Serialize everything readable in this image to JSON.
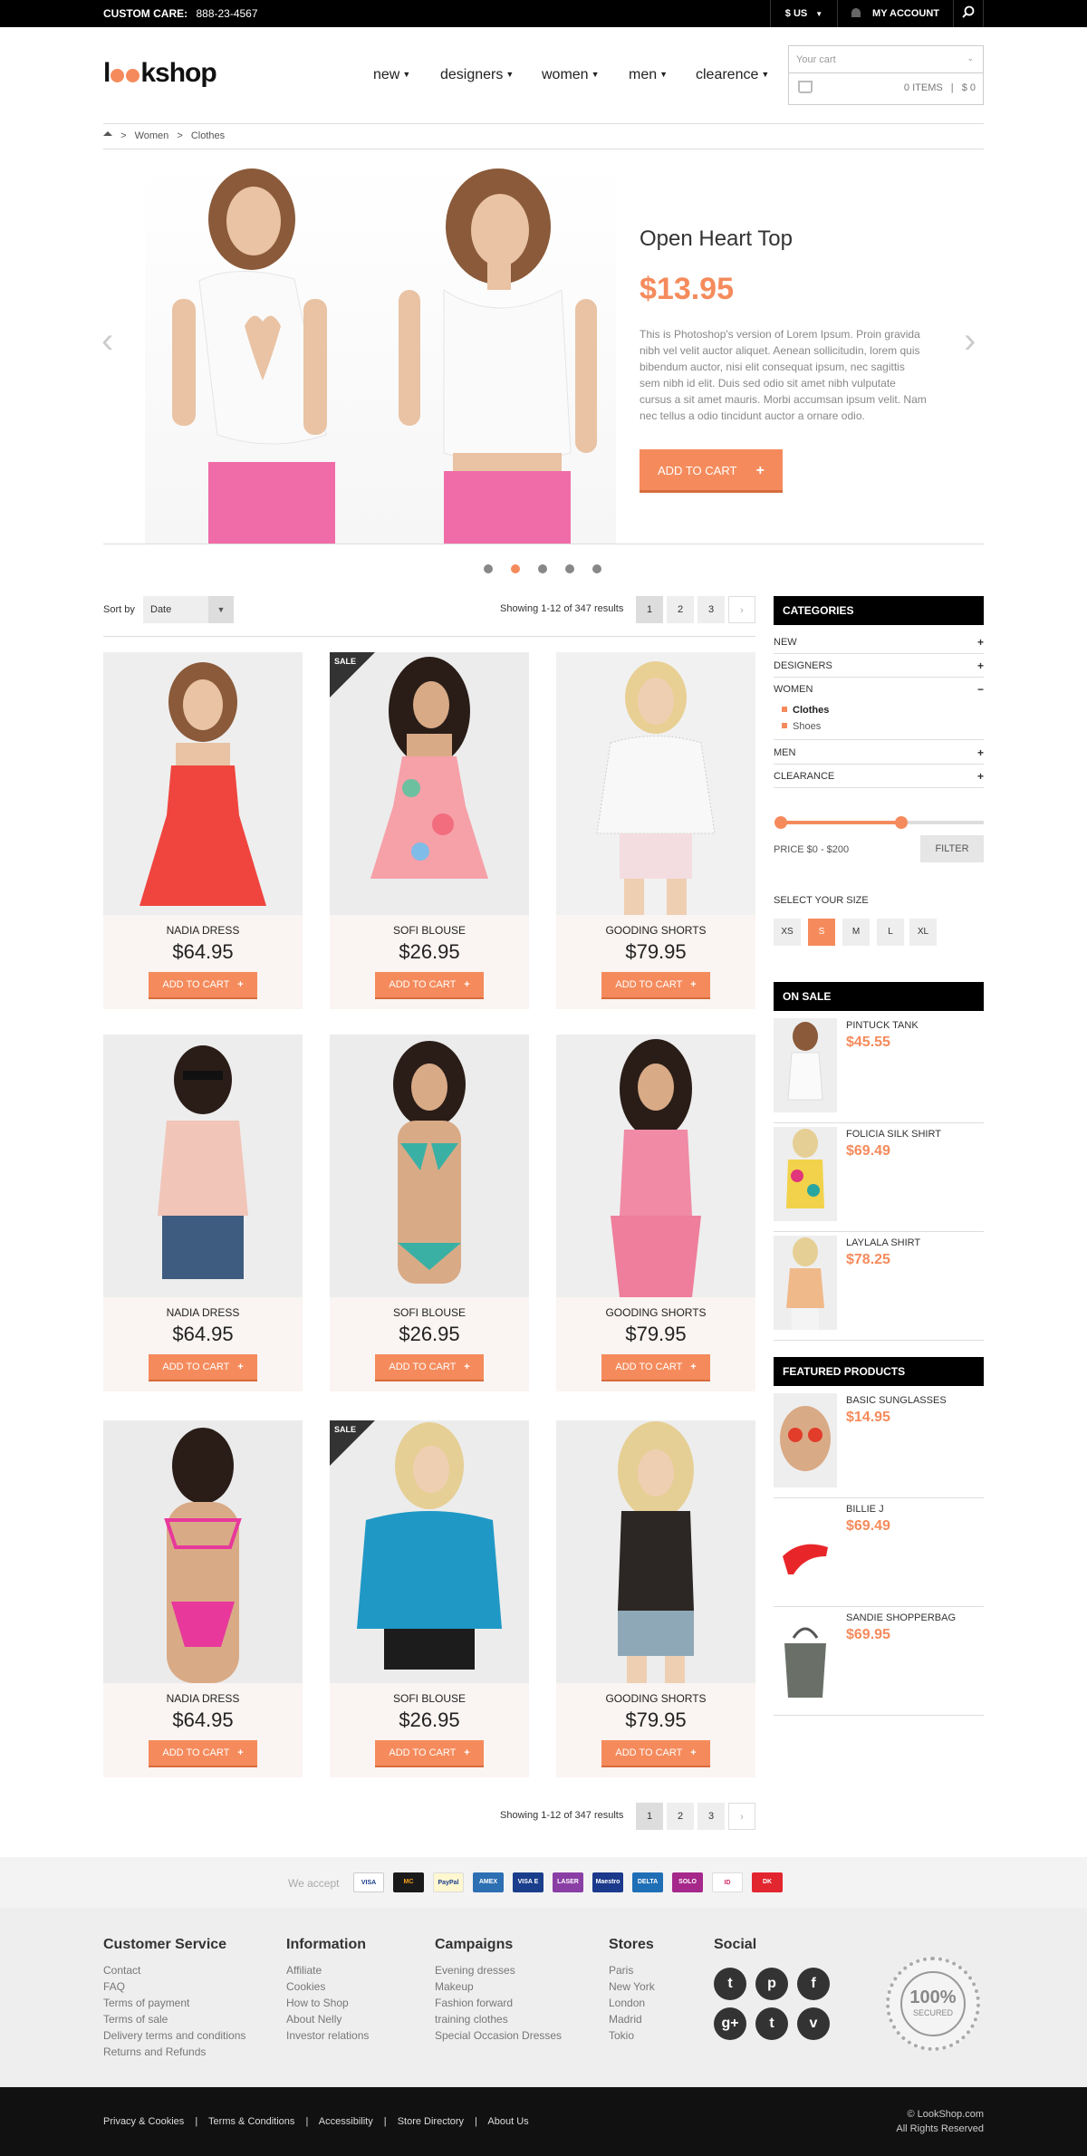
{
  "topbar": {
    "care_label": "CUSTOM CARE:",
    "care_number": "888-23-4567",
    "currency": "$ US",
    "account": "MY ACCOUNT"
  },
  "header": {
    "logo_pre": "l",
    "logo_post": "kshop",
    "nav": [
      "new",
      "designers",
      "women",
      "men",
      "clearence"
    ],
    "cart_label": "Your cart",
    "cart_items": "0 ITEMS",
    "cart_total": "$ 0"
  },
  "breadcrumb": {
    "sep": ">",
    "items": [
      "Women",
      "Clothes"
    ]
  },
  "hero": {
    "title": "Open Heart Top",
    "price": "$13.95",
    "description": "This is Photoshop's version  of Lorem Ipsum. Proin gravida nibh vel velit auctor aliquet. Aenean sollicitudin, lorem quis bibendum auctor, nisi elit consequat ipsum, nec sagittis sem nibh id elit. Duis sed odio sit amet nibh vulputate cursus a sit amet mauris. Morbi accumsan ipsum velit. Nam nec tellus a odio tincidunt auctor a ornare odio.",
    "button": "ADD TO CART",
    "slide_active": 2,
    "slide_count": 5
  },
  "toolbar": {
    "sort_label": "Sort by",
    "sort_value": "Date",
    "showing": "Showing 1-12 of 347 results",
    "pages": [
      "1",
      "2",
      "3"
    ],
    "next": "›"
  },
  "products": [
    {
      "name": "NADIA DRESS",
      "price": "$64.95",
      "button": "ADD TO CART",
      "sale": false
    },
    {
      "name": "SOFI BLOUSE",
      "price": "$26.95",
      "button": "ADD TO CART",
      "sale": true,
      "sale_label": "SALE"
    },
    {
      "name": "GOODING SHORTS",
      "price": "$79.95",
      "button": "ADD TO CART",
      "sale": false
    },
    {
      "name": "NADIA DRESS",
      "price": "$64.95",
      "button": "ADD TO CART",
      "sale": false
    },
    {
      "name": "SOFI BLOUSE",
      "price": "$26.95",
      "button": "ADD TO CART",
      "sale": false
    },
    {
      "name": "GOODING SHORTS",
      "price": "$79.95",
      "button": "ADD TO CART",
      "sale": false
    },
    {
      "name": "NADIA DRESS",
      "price": "$64.95",
      "button": "ADD TO CART",
      "sale": false
    },
    {
      "name": "SOFI BLOUSE",
      "price": "$26.95",
      "button": "ADD TO CART",
      "sale": true,
      "sale_label": "SALE"
    },
    {
      "name": "GOODING SHORTS",
      "price": "$79.95",
      "button": "ADD TO CART",
      "sale": false
    }
  ],
  "sidebar": {
    "categories_title": "CATEGORIES",
    "categories": [
      {
        "label": "NEW",
        "sign": "+"
      },
      {
        "label": "DESIGNERS",
        "sign": "+"
      },
      {
        "label": "WOMEN",
        "sign": "−"
      },
      {
        "label": "MEN",
        "sign": "+"
      },
      {
        "label": "CLEARANCE",
        "sign": "+"
      }
    ],
    "subcategories": [
      "Clothes",
      "Shoes"
    ],
    "price_label": "PRICE $0 - $200",
    "filter_button": "FILTER",
    "size_title": "SELECT YOUR SIZE",
    "sizes": [
      "XS",
      "S",
      "M",
      "L",
      "XL"
    ],
    "selected_size": "S",
    "onsale_title": "ON SALE",
    "onsale": [
      {
        "name": "PINTUCK TANK",
        "price": "$45.55"
      },
      {
        "name": "FOLICIA SILK SHIRT",
        "price": "$69.49"
      },
      {
        "name": "LAYLALA SHIRT",
        "price": "$78.25"
      }
    ],
    "featured_title": "FEATURED PRODUCTS",
    "featured": [
      {
        "name": "BASIC SUNGLASSES",
        "price": "$14.95"
      },
      {
        "name": "BILLIE J",
        "price": "$69.49"
      },
      {
        "name": "SANDIE SHOPPERBAG",
        "price": "$69.95"
      }
    ]
  },
  "payments": {
    "label": "We accept",
    "cards": [
      "VISA",
      "MC",
      "PayPal",
      "AMEX",
      "VISA E",
      "LASER",
      "Maestro",
      "DELTA",
      "SOLO",
      "ID",
      "DK"
    ]
  },
  "footer": {
    "columns": [
      {
        "title": "Customer Service",
        "links": [
          "Contact",
          "FAQ",
          "Terms of payment",
          "Terms of sale",
          "Delivery terms and conditions",
          "Returns and Refunds"
        ]
      },
      {
        "title": "Information",
        "links": [
          "Affiliate",
          "Cookies",
          "How to Shop",
          "About Nelly",
          "Investor relations"
        ]
      },
      {
        "title": "Campaigns",
        "links": [
          "Evening dresses",
          "Makeup",
          "Fashion forward",
          "training clothes",
          "Special Occasion Dresses"
        ]
      },
      {
        "title": "Stores",
        "links": [
          "Paris",
          "New York",
          "London",
          "Madrid",
          "Tokio"
        ]
      }
    ],
    "social_title": "Social",
    "social": [
      "t",
      "p",
      "f",
      "g+",
      "t",
      "v"
    ],
    "seal_pct": "100%",
    "seal_label": "SECURED",
    "bottom_links": [
      "Privacy & Cookies",
      "Terms & Conditions",
      "Accessibility",
      "Store Directory",
      "About Us"
    ],
    "copyright": "© LookShop.com",
    "rights": "All Rights Reserved"
  },
  "colors": {
    "accent": "#f58b5c",
    "dark": "#000000"
  }
}
